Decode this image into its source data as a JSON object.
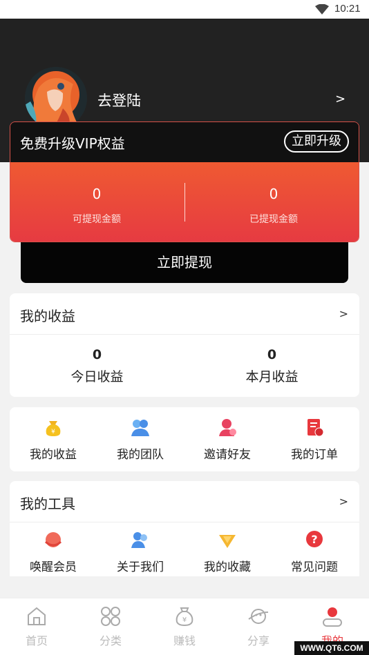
{
  "status_bar": {
    "time": "10:21"
  },
  "profile": {
    "login_label": "去登陆",
    "arrow": ">"
  },
  "vip": {
    "title": "免费升级VIP权益",
    "upgrade_label": "立即升级",
    "withdrawable_amount": "0",
    "withdrawable_label": "可提现金额",
    "withdrawn_amount": "0",
    "withdrawn_label": "已提现金额"
  },
  "withdraw_button": "立即提现",
  "earnings": {
    "title": "我的收益",
    "arrow": ">",
    "today_value": "0",
    "today_label": "今日收益",
    "month_value": "0",
    "month_label": "本月收益"
  },
  "menu": [
    {
      "label": "我的收益",
      "icon": "money-bag-icon"
    },
    {
      "label": "我的团队",
      "icon": "team-icon"
    },
    {
      "label": "邀请好友",
      "icon": "invite-icon"
    },
    {
      "label": "我的订单",
      "icon": "order-icon"
    }
  ],
  "tools": {
    "title": "我的工具",
    "arrow": ">",
    "items": [
      {
        "label": "唤醒会员",
        "icon": "wake-icon"
      },
      {
        "label": "关于我们",
        "icon": "about-icon"
      },
      {
        "label": "我的收藏",
        "icon": "favorite-tag-icon"
      },
      {
        "label": "常见问题",
        "icon": "question-icon"
      }
    ]
  },
  "tabbar": [
    {
      "label": "首页",
      "icon": "home-icon"
    },
    {
      "label": "分类",
      "icon": "category-icon"
    },
    {
      "label": "赚钱",
      "icon": "money-icon"
    },
    {
      "label": "分享",
      "icon": "share-icon"
    },
    {
      "label": "我的",
      "icon": "profile-icon",
      "active": true
    }
  ],
  "watermark": "WWW.QT6.COM",
  "colors": {
    "accent": "#e8383d",
    "header_bg": "#222222",
    "vip_gradient_top": "#ef5a32",
    "vip_gradient_bottom": "#e63a42"
  }
}
